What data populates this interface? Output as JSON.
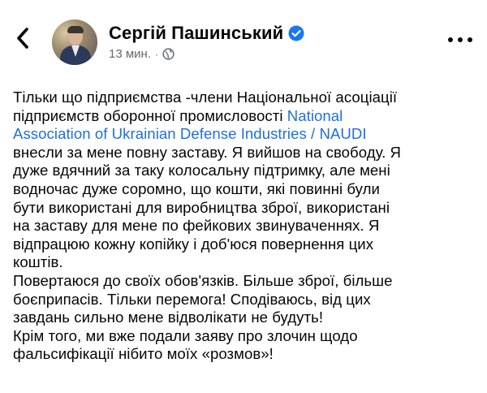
{
  "header": {
    "author_name": "Сергій Пашинський",
    "time": "13 мин.",
    "separator": "·"
  },
  "post": {
    "lines": [
      "Тільки що підприємства -члени Національної асоціації",
      "підприємств оборонної промисловості ",
      "Association of Ukrainian Defense Industries / NAUDI",
      "внесли за мене повну заставу. Я вийшов на свободу. Я",
      "дуже вдячний за таку колосальну підтримку, але мені",
      "водночас дуже соромно, що кошти, які повинні були",
      "бути використані для виробництва зброї, використані",
      "на заставу для мене по фейкових звинуваченнях. Я",
      "відпрацюю кожну копійку і доб'юся повернення цих",
      "коштів.",
      "Повертаюся до своїх обов'язків. Більше зброї, більше",
      "боєприпасів. Тільки перемога! Сподіваюсь, від цих",
      "завдань сильно мене відволікати не будуть!",
      "Крім того, ми вже подали заяву про злочин щодо",
      "фальсифікації нібито моїх «розмов»!"
    ],
    "link_part1": "National"
  },
  "colors": {
    "link": "#216fdb",
    "verified_badge": "#1877f2",
    "meta_text": "#65676b"
  },
  "icons": {
    "back": "chevron-left-icon",
    "verified": "verified-badge-icon",
    "audience": "globe-icon",
    "more": "more-options-icon"
  }
}
